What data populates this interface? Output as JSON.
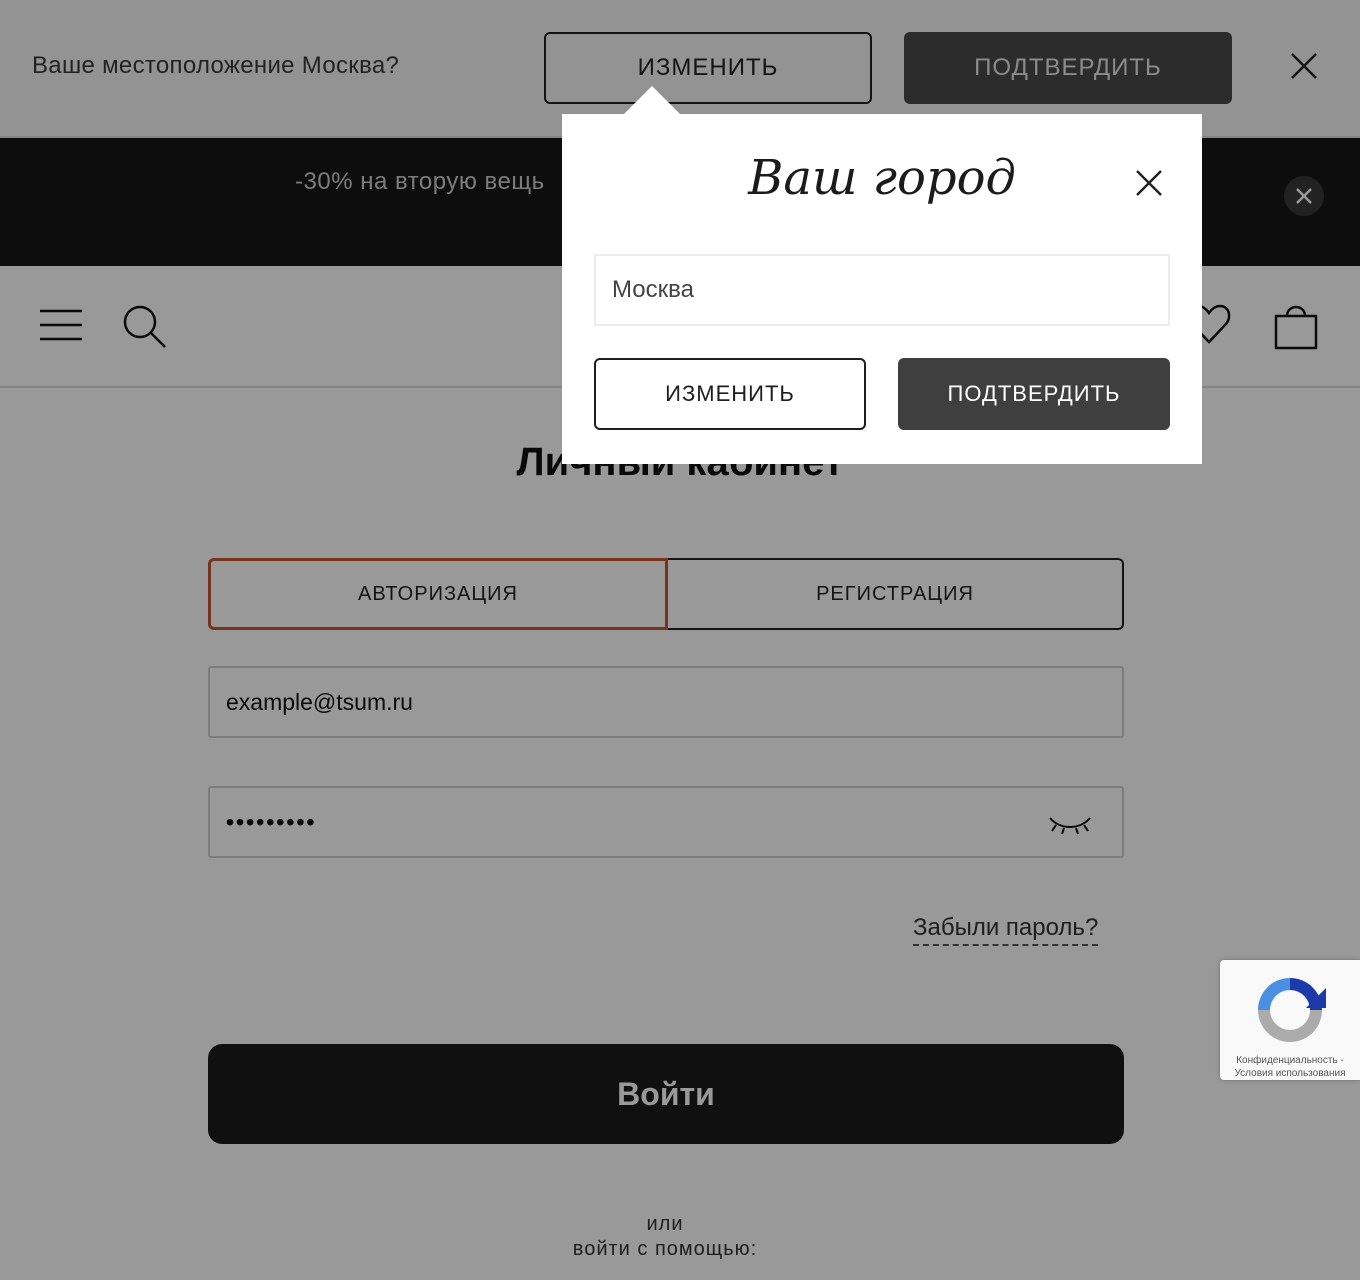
{
  "location_bar": {
    "question": "Ваше местоположение Москва?",
    "change_label": "ИЗМЕНИТЬ",
    "confirm_label": "ПОДТВЕРДИТЬ"
  },
  "promo": {
    "text": "-30% на вторую вещь"
  },
  "main": {
    "title": "Личный кабинет",
    "tabs": [
      {
        "label": "АВТОРИЗАЦИЯ",
        "active": true
      },
      {
        "label": "РЕГИСТРАЦИЯ",
        "active": false
      }
    ],
    "email_value": "example@tsum.ru",
    "password_value": "•••••••••",
    "forgot_label": "Забыли пароль?",
    "login_label": "Войти",
    "or_label": "или",
    "social_label": "войти с помощью:"
  },
  "city_modal": {
    "title": "Ваш город",
    "input_value": "Москва",
    "change_label": "ИЗМЕНИТЬ",
    "confirm_label": "ПОДТВЕРДИТЬ"
  },
  "recaptcha": {
    "privacy": "Конфиденциальность -",
    "terms": "Условия использования"
  },
  "colors": {
    "active_tab_border": "#c9562e",
    "dark_button": "#3f3f3f",
    "promo_bg": "#161616"
  }
}
